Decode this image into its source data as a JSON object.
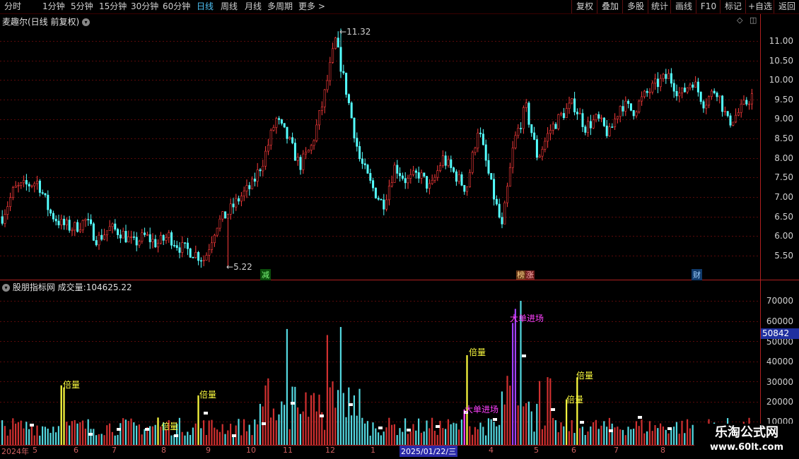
{
  "toolbar": {
    "periods": [
      "分时",
      "1分钟",
      "5分钟",
      "15分钟",
      "30分钟",
      "60分钟",
      "日线",
      "周线",
      "月线",
      "多周期",
      "更多 >"
    ],
    "right_buttons": [
      "复权",
      "叠加",
      "多股",
      "统计",
      "画线",
      "F10",
      "+自选",
      "返回",
      "标记"
    ]
  },
  "price_panel": {
    "title": "麦趣尔(日线 前复权)",
    "high_label": "11.32",
    "low_label": "5.22",
    "y_ticks": [
      "11.00",
      "10.50",
      "10.00",
      "9.50",
      "9.00",
      "8.50",
      "8.00",
      "7.50",
      "7.00",
      "6.50",
      "6.00",
      "5.50"
    ],
    "event_markers": {
      "m1": "减",
      "m2": "榜",
      "m3": "涨",
      "m4": "财"
    }
  },
  "volume_panel": {
    "title": "股朋指标网",
    "indicator_label": "成交量:",
    "indicator_value": "104625.22",
    "y_ticks": [
      "70000",
      "60000",
      "50000",
      "40000",
      "30000",
      "20000",
      "10000"
    ],
    "current_badge": "50842",
    "annotations": {
      "a1": "倍量",
      "a2": "倍量",
      "a3": "倍量",
      "a4": "倍量",
      "a5": "倍量",
      "a6": "倍量",
      "big1": "大单进场",
      "big2": "大单进场"
    }
  },
  "date_axis": {
    "labels": [
      "2024年",
      "5",
      "6",
      "7",
      "8",
      "9",
      "10",
      "11",
      "12",
      "1",
      "2025/01/22/三",
      "4",
      "5",
      "6",
      "7",
      "8"
    ]
  },
  "watermark": {
    "line1": "乐淘公式网",
    "line2": "www.60lt.com"
  },
  "chart_data": {
    "type": "candlestick",
    "price_range": [
      5.0,
      11.6
    ],
    "volume_range": [
      0,
      75000
    ],
    "high": 11.32,
    "low": 5.22,
    "close_path": [
      6.5,
      7.2,
      7.3,
      7.4,
      6.6,
      6.3,
      6.2,
      6.4,
      5.9,
      6.2,
      6.1,
      5.8,
      6.0,
      5.8,
      6.0,
      5.7,
      5.6,
      5.4,
      6.3,
      6.6,
      7.0,
      7.3,
      8.0,
      9.0,
      8.5,
      7.8,
      8.3,
      9.5,
      11.0,
      9.6,
      8.0,
      7.3,
      6.8,
      7.8,
      7.4,
      7.6,
      7.2,
      8.0,
      7.6,
      7.2,
      8.8,
      7.4,
      6.2,
      8.4,
      9.3,
      8.0,
      8.7,
      9.1,
      9.4,
      8.8,
      9.0,
      8.6,
      9.4,
      9.2,
      9.6,
      9.9,
      10.1,
      9.6,
      10.0,
      9.4,
      9.8,
      8.9,
      9.2,
      9.6
    ]
  }
}
